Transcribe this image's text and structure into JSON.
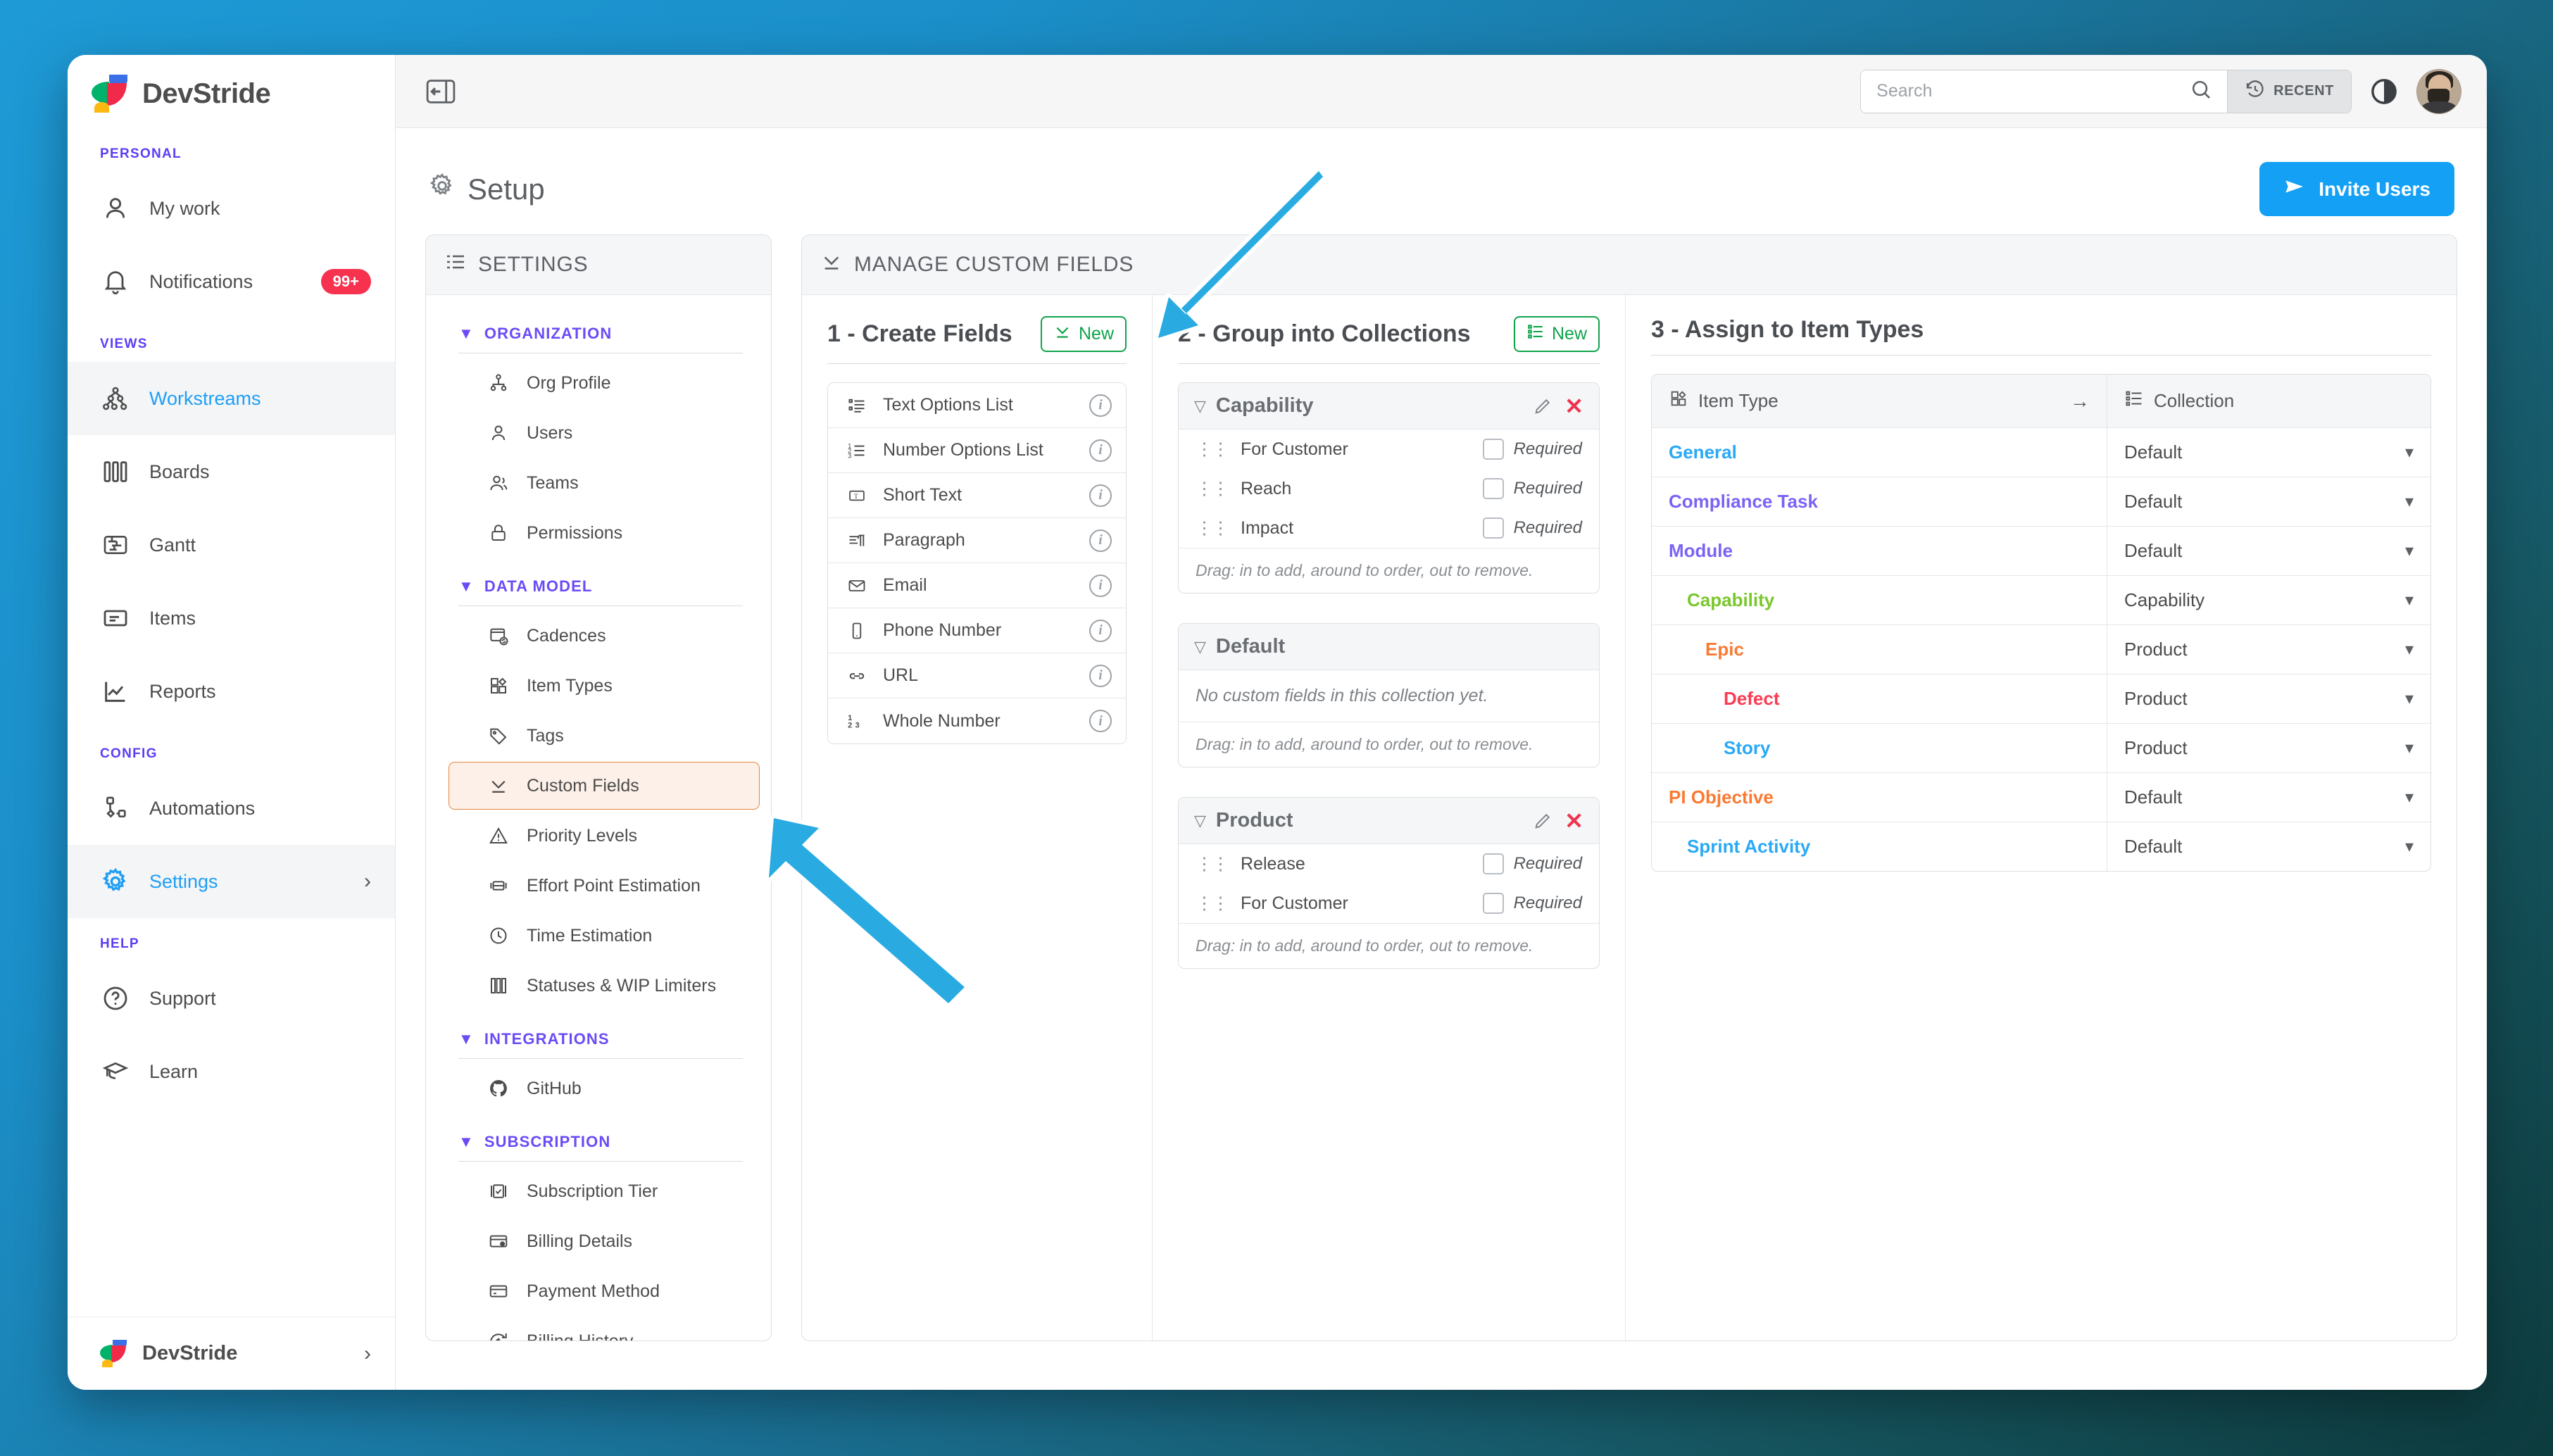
{
  "app": {
    "brand_name": "DevStride",
    "footer_workspace": "DevStride"
  },
  "sidebar": {
    "groups": [
      {
        "label": "PERSONAL",
        "items": [
          {
            "label": "My work",
            "icon": "user-icon",
            "active": false
          },
          {
            "label": "Notifications",
            "icon": "bell-icon",
            "badge": "99+",
            "active": false
          }
        ]
      },
      {
        "label": "VIEWS",
        "items": [
          {
            "label": "Workstreams",
            "icon": "workstreams-icon",
            "active": true
          },
          {
            "label": "Boards",
            "icon": "boards-icon",
            "active": false
          },
          {
            "label": "Gantt",
            "icon": "gantt-icon",
            "active": false
          },
          {
            "label": "Items",
            "icon": "items-icon",
            "active": false
          },
          {
            "label": "Reports",
            "icon": "reports-icon",
            "active": false
          }
        ]
      },
      {
        "label": "CONFIG",
        "items": [
          {
            "label": "Automations",
            "icon": "automations-icon",
            "active": false
          },
          {
            "label": "Settings",
            "icon": "gear-icon",
            "active": true,
            "chevron": "›"
          }
        ]
      },
      {
        "label": "HELP",
        "items": [
          {
            "label": "Support",
            "icon": "question-circle-icon",
            "active": false
          },
          {
            "label": "Learn",
            "icon": "graduation-cap-icon",
            "active": false
          }
        ]
      }
    ]
  },
  "topbar": {
    "collapse_icon": "collapse-sidebar-icon",
    "search_placeholder": "Search",
    "search_value": "",
    "recent_label": "RECENT",
    "theme_toggle_icon": "contrast-icon"
  },
  "page": {
    "title": "Setup",
    "title_icon": "gear-icon",
    "invite_label": "Invite Users",
    "invite_icon": "send-icon",
    "accent_blue": "#14a0f5"
  },
  "settings_panel": {
    "header": "SETTINGS",
    "header_icon": "list-settings-icon",
    "groups": [
      {
        "label": "ORGANIZATION",
        "items": [
          {
            "label": "Org Profile",
            "icon": "org-chart-icon",
            "active": false
          },
          {
            "label": "Users",
            "icon": "user-icon",
            "active": false
          },
          {
            "label": "Teams",
            "icon": "users-icon",
            "active": false
          },
          {
            "label": "Permissions",
            "icon": "lock-icon",
            "active": false
          }
        ]
      },
      {
        "label": "DATA MODEL",
        "items": [
          {
            "label": "Cadences",
            "icon": "cadence-icon",
            "active": false
          },
          {
            "label": "Item Types",
            "icon": "item-types-icon",
            "active": false
          },
          {
            "label": "Tags",
            "icon": "tag-icon",
            "active": false
          },
          {
            "label": "Custom Fields",
            "icon": "custom-fields-icon",
            "active": true
          },
          {
            "label": "Priority Levels",
            "icon": "warning-triangle-icon",
            "active": false
          },
          {
            "label": "Effort Point Estimation",
            "icon": "dumbbell-icon",
            "active": false
          },
          {
            "label": "Time Estimation",
            "icon": "clock-icon",
            "active": false
          },
          {
            "label": "Statuses & WIP Limiters",
            "icon": "columns-icon",
            "active": false
          }
        ]
      },
      {
        "label": "INTEGRATIONS",
        "items": [
          {
            "label": "GitHub",
            "icon": "github-icon",
            "active": false
          }
        ]
      },
      {
        "label": "SUBSCRIPTION",
        "items": [
          {
            "label": "Subscription Tier",
            "icon": "subscription-tier-icon",
            "active": false
          },
          {
            "label": "Billing Details",
            "icon": "billing-details-icon",
            "active": false
          },
          {
            "label": "Payment Method",
            "icon": "credit-card-icon",
            "active": false
          },
          {
            "label": "Billing History",
            "icon": "billing-history-icon",
            "active": false
          }
        ]
      }
    ]
  },
  "manage_panel": {
    "header": "MANAGE CUSTOM FIELDS",
    "header_icon": "custom-fields-icon",
    "step1": {
      "title": "1 - Create Fields",
      "new_label": "New",
      "new_icon": "custom-fields-icon",
      "fields": [
        {
          "label": "Text Options List",
          "icon": "text-options-list-icon"
        },
        {
          "label": "Number Options List",
          "icon": "number-options-list-icon"
        },
        {
          "label": "Short Text",
          "icon": "short-text-icon"
        },
        {
          "label": "Paragraph",
          "icon": "paragraph-icon"
        },
        {
          "label": "Email",
          "icon": "email-icon"
        },
        {
          "label": "Phone Number",
          "icon": "phone-icon"
        },
        {
          "label": "URL",
          "icon": "link-icon"
        },
        {
          "label": "Whole Number",
          "icon": "whole-number-icon"
        }
      ]
    },
    "step2": {
      "title": "2 - Group into Collections",
      "new_label": "New",
      "new_icon": "collection-icon",
      "drag_hint": "Drag: in to add, around to order, out to remove.",
      "empty_text": "No custom fields in this collection yet.",
      "required_label": "Required",
      "collections": [
        {
          "name": "Capability",
          "editable": true,
          "fields": [
            {
              "name": "For Customer",
              "required": false
            },
            {
              "name": "Reach",
              "required": false
            },
            {
              "name": "Impact",
              "required": false
            }
          ]
        },
        {
          "name": "Default",
          "editable": false,
          "fields": []
        },
        {
          "name": "Product",
          "editable": true,
          "fields": [
            {
              "name": "Release",
              "required": false
            },
            {
              "name": "For Customer",
              "required": false
            }
          ]
        }
      ]
    },
    "step3": {
      "title": "3 - Assign to Item Types",
      "col_item_type": "Item Type",
      "col_item_type_icon": "item-types-icon",
      "col_collection": "Collection",
      "col_collection_icon": "collection-icon",
      "rows": [
        {
          "item_type": "General",
          "color": "#2aa9f5",
          "indent": 0,
          "collection": "Default"
        },
        {
          "item_type": "Compliance Task",
          "color": "#7a63f5",
          "indent": 0,
          "collection": "Default"
        },
        {
          "item_type": "Module",
          "color": "#7a63f5",
          "indent": 0,
          "collection": "Default"
        },
        {
          "item_type": "Capability",
          "color": "#7ac72e",
          "indent": 1,
          "collection": "Capability"
        },
        {
          "item_type": "Epic",
          "color": "#fa7a33",
          "indent": 2,
          "collection": "Product"
        },
        {
          "item_type": "Defect",
          "color": "#fa3b52",
          "indent": 3,
          "collection": "Product"
        },
        {
          "item_type": "Story",
          "color": "#2aa9f5",
          "indent": 3,
          "collection": "Product"
        },
        {
          "item_type": "PI Objective",
          "color": "#fa7a33",
          "indent": 0,
          "collection": "Default"
        },
        {
          "item_type": "Sprint Activity",
          "color": "#2aa9f5",
          "indent": 1,
          "collection": "Default"
        }
      ]
    }
  },
  "annotations": {
    "arrow_color": "#29ABE2",
    "arrow_outline": "#ffffff",
    "arrows": [
      {
        "name": "arrow-to-create-fields-new",
        "points_to": "1 - Create Fields New button"
      },
      {
        "name": "arrow-to-custom-fields-nav",
        "points_to": "Custom Fields settings item"
      }
    ]
  }
}
